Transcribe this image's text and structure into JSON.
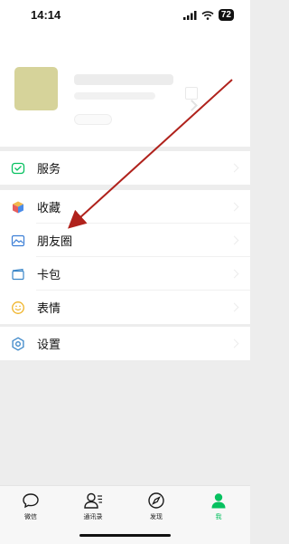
{
  "status_bar": {
    "time": "14:14",
    "battery": "72"
  },
  "menu": {
    "services": {
      "label": "服务"
    },
    "favorites": {
      "label": "收藏"
    },
    "moments": {
      "label": "朋友圈"
    },
    "cards": {
      "label": "卡包"
    },
    "stickers": {
      "label": "表情"
    },
    "settings": {
      "label": "设置"
    }
  },
  "tabbar": {
    "tabs": [
      {
        "label": "微信",
        "icon": "chat-bubble-icon"
      },
      {
        "label": "通讯录",
        "icon": "contacts-icon"
      },
      {
        "label": "发现",
        "icon": "compass-icon"
      },
      {
        "label": "我",
        "icon": "person-icon"
      }
    ],
    "active": "我"
  },
  "colors": {
    "accent": "#07c160",
    "annotation_arrow": "#b0221c"
  }
}
